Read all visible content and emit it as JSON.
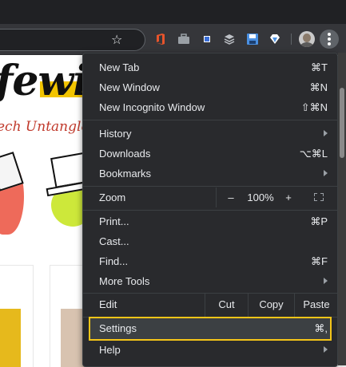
{
  "toolbar": {
    "star_icon_glyph": "☆",
    "extension_icons": [
      "office-icon",
      "briefcase-icon",
      "square-icon",
      "buffer-icon",
      "floppy-disk-icon",
      "diamond-icon"
    ],
    "avatar": "user-avatar",
    "menu_button": "more-vert-icon"
  },
  "page": {
    "logo_text": "fewi",
    "tagline": "ech Untangle"
  },
  "menu": {
    "new_tab": {
      "label": "New Tab",
      "shortcut": "⌘T"
    },
    "new_window": {
      "label": "New Window",
      "shortcut": "⌘N"
    },
    "new_incognito": {
      "label": "New Incognito Window",
      "shortcut": "⇧⌘N"
    },
    "history": {
      "label": "History"
    },
    "downloads": {
      "label": "Downloads",
      "shortcut": "⌥⌘L"
    },
    "bookmarks": {
      "label": "Bookmarks"
    },
    "zoom": {
      "label": "Zoom",
      "minus": "–",
      "level": "100%",
      "plus": "+"
    },
    "print": {
      "label": "Print...",
      "shortcut": "⌘P"
    },
    "cast": {
      "label": "Cast..."
    },
    "find": {
      "label": "Find...",
      "shortcut": "⌘F"
    },
    "more_tools": {
      "label": "More Tools"
    },
    "edit": {
      "label": "Edit",
      "cut": "Cut",
      "copy": "Copy",
      "paste": "Paste"
    },
    "settings": {
      "label": "Settings",
      "shortcut": "⌘,"
    },
    "help": {
      "label": "Help"
    }
  },
  "colors": {
    "menu_bg": "#292a2d",
    "highlight_outline": "#f5c518",
    "toolbar_bg": "#35363a"
  }
}
